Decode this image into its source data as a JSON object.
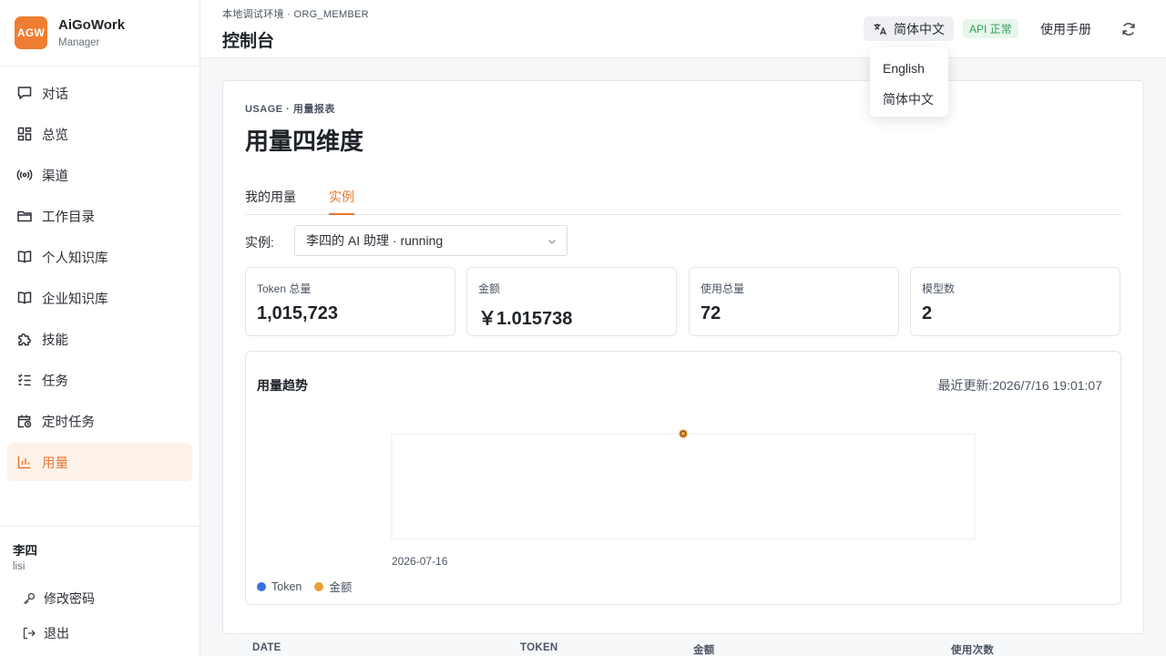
{
  "brand": {
    "logo": "AGW",
    "name": "AiGoWork",
    "sub": "Manager"
  },
  "sidebar": {
    "items": [
      {
        "label": "对话",
        "icon": "chat-icon"
      },
      {
        "label": "总览",
        "icon": "dashboard-icon"
      },
      {
        "label": "渠道",
        "icon": "broadcast-icon"
      },
      {
        "label": "工作目录",
        "icon": "folder-icon"
      },
      {
        "label": "个人知识库",
        "icon": "book-icon"
      },
      {
        "label": "企业知识库",
        "icon": "book-icon"
      },
      {
        "label": "技能",
        "icon": "puzzle-icon"
      },
      {
        "label": "任务",
        "icon": "checklist-icon"
      },
      {
        "label": "定时任务",
        "icon": "calendar-clock-icon"
      },
      {
        "label": "用量",
        "icon": "bar-chart-icon",
        "active": true
      }
    ]
  },
  "user": {
    "name": "李四",
    "id": "lisi",
    "change_password": "修改密码",
    "logout": "退出"
  },
  "topbar": {
    "env": "本地调试环境 · ORG_MEMBER",
    "title": "控制台",
    "lang_label": "简体中文",
    "api_status": "API 正常",
    "manual": "使用手册"
  },
  "lang_dropdown": {
    "options": [
      "English",
      "简体中文"
    ]
  },
  "card": {
    "kicker": "USAGE · 用量报表",
    "title": "用量四维度",
    "tabs": [
      {
        "label": "我的用量"
      },
      {
        "label": "实例",
        "active": true
      }
    ],
    "instance_label": "实例:",
    "instance_value": "李四的 AI 助理 · running",
    "stats": [
      {
        "label": "Token 总量",
        "value": "1,015,723"
      },
      {
        "label": "金额",
        "value": "￥1.015738"
      },
      {
        "label": "使用总量",
        "value": "72"
      },
      {
        "label": "模型数",
        "value": "2"
      }
    ]
  },
  "chart": {
    "title": "用量趋势",
    "updated": "最近更新:2026/7/16 19:01:07",
    "legend": [
      "Token",
      "金额"
    ]
  },
  "chart_data": {
    "type": "line",
    "x": [
      "2026-07-16"
    ],
    "series": [
      {
        "name": "Token",
        "values": [
          1015723
        ],
        "color": "#3b6fe0"
      },
      {
        "name": "金额",
        "values": [
          1.015738
        ],
        "color": "#e8a035"
      }
    ]
  },
  "colors": {
    "accent": "#e8772f",
    "token": "#3b6fe0",
    "amount": "#e8a035",
    "ok": "#2f9e54"
  },
  "table": {
    "headers": [
      "DATE",
      "TOKEN",
      "金额",
      "使用次数"
    ]
  }
}
